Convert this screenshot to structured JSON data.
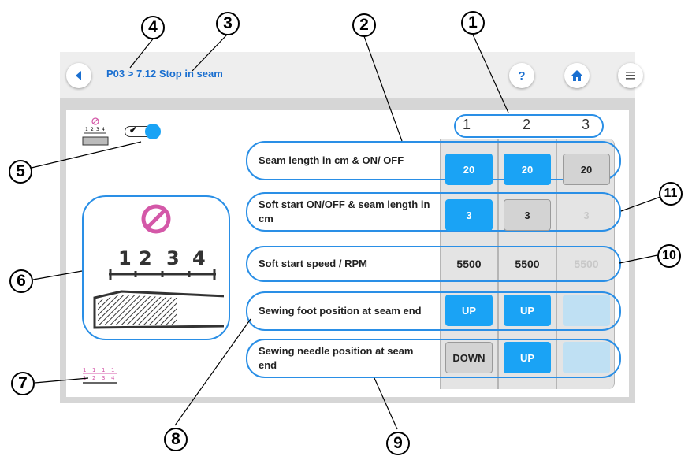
{
  "breadcrumb": "P03 > 7.12 Stop in seam",
  "columns": [
    "1",
    "2",
    "3"
  ],
  "rows": [
    {
      "label": "Seam length in cm & ON/ OFF",
      "cells": [
        "20",
        "20",
        "20"
      ],
      "states": [
        "on",
        "on",
        "off"
      ]
    },
    {
      "label": "Soft start ON/OFF & seam length in cm",
      "cells": [
        "3",
        "3",
        "3"
      ],
      "states": [
        "on",
        "off",
        "disabled"
      ]
    },
    {
      "label": "Soft start speed / RPM",
      "cells": [
        "5500",
        "5500",
        "5500"
      ],
      "states": [
        "plain",
        "plain",
        "disabled"
      ]
    },
    {
      "label": "Sewing foot position at seam end",
      "cells": [
        "UP",
        "UP",
        ""
      ],
      "states": [
        "on",
        "on",
        "pale"
      ]
    },
    {
      "label": "Sewing needle position at seam end",
      "cells": [
        "DOWN",
        "UP",
        ""
      ],
      "states": [
        "off",
        "on",
        "pale"
      ]
    }
  ],
  "callouts": [
    "1",
    "2",
    "3",
    "4",
    "5",
    "6",
    "7",
    "8",
    "9",
    "10",
    "11"
  ],
  "illustration": {
    "ruler_labels": [
      "1",
      "2",
      "3",
      "4"
    ]
  },
  "small_icon": {
    "ruler_labels": [
      "1",
      "2",
      "3",
      "4"
    ]
  },
  "ruler_icon": {
    "top_labels": [
      "1",
      "1",
      "1",
      "1"
    ],
    "bottom_labels": [
      "1",
      "2",
      "3",
      "4"
    ]
  },
  "colors": {
    "accent": "#1aa3f5",
    "outline": "#2a8fe6",
    "breadcrumb": "#1a6fd0",
    "stop": "#d458a8"
  },
  "icons": {
    "back": "back-arrow-icon",
    "help": "help-icon",
    "home": "home-icon",
    "menu": "menu-icon"
  },
  "toggle": {
    "checked": true
  }
}
